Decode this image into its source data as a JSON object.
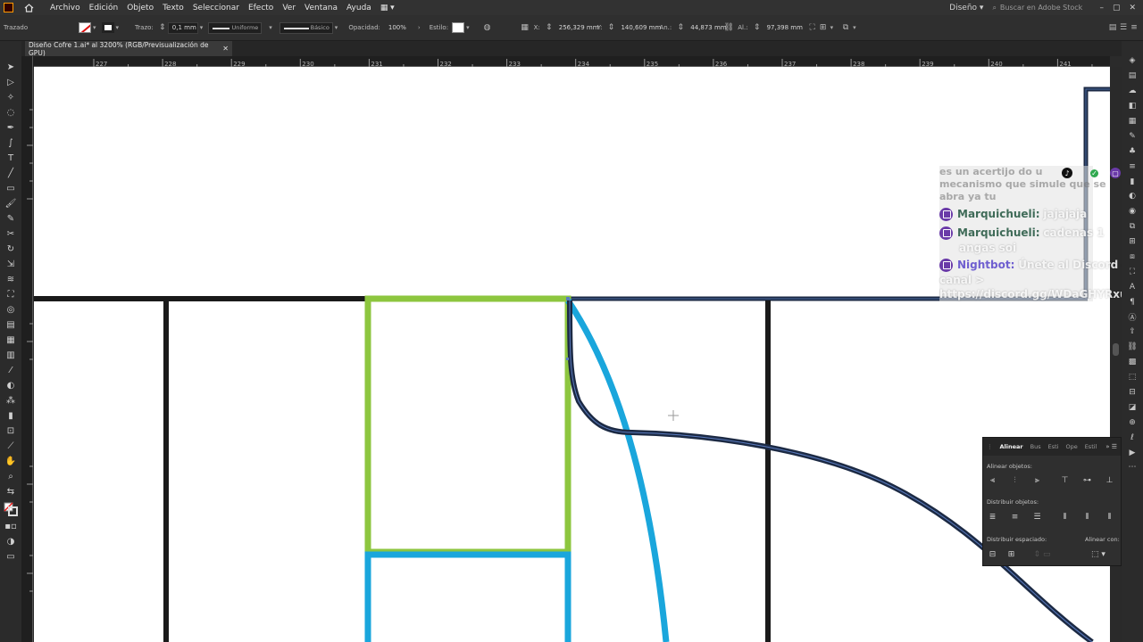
{
  "menubar": {
    "items": [
      "Archivo",
      "Edición",
      "Objeto",
      "Texto",
      "Seleccionar",
      "Efecto",
      "Ver",
      "Ventana",
      "Ayuda"
    ],
    "workspace": "Diseño",
    "search_placeholder": "Buscar en Adobe Stock"
  },
  "controlbar": {
    "object_label": "Trazado",
    "stroke_label": "Trazo:",
    "stroke_weight": "0,1 mm",
    "profile": "Uniforme",
    "brush": "Básico",
    "opacity_label": "Opacidad:",
    "opacity_value": "100%",
    "style_label": "Estilo:",
    "x_label": "X:",
    "x_value": "256,329 mm",
    "y_label": "Y:",
    "y_value": "140,609 mm",
    "w_label": "An.:",
    "w_value": "44,873 mm",
    "h_label": "Al.:",
    "h_value": "97,398 mm"
  },
  "document": {
    "tab_title": "Diseño Cofre 1.ai* al 3200% (RGB/Previsualización de GPU)"
  },
  "ruler": {
    "top_ticks": [
      "227",
      "228",
      "229",
      "230",
      "231",
      "232",
      "233",
      "234",
      "235",
      "236",
      "237",
      "238",
      "239",
      "240",
      "241"
    ]
  },
  "chat": {
    "faded_line_1": "es un acertijo do u",
    "faded_line_2": "mecanismo que simule que se",
    "faded_line_3": "abra ya tu",
    "messages": [
      {
        "user": "Marquichueli:",
        "text": "jajajaja"
      },
      {
        "user": "Marquichueli:",
        "text": "cadenas 1"
      },
      {
        "user": "Nightbot:",
        "text": "Únete al Discord del"
      }
    ],
    "faded_line_4": "angas soi",
    "nightbot_line_2": "canal >",
    "nightbot_link": "https://discord.gg/WDaGHYRxuX"
  },
  "align_panel": {
    "tabs": [
      "Alinear",
      "Bus",
      "Esti",
      "Ope",
      "Estil"
    ],
    "align_objects_label": "Alinear objetos:",
    "distribute_objects_label": "Distribuir objetos:",
    "distribute_spacing_label": "Distribuir espaciado:",
    "align_to_label": "Alinear con:"
  },
  "colors": {
    "green_stroke": "#8dc63f",
    "blue_stroke": "#1aa6dc",
    "black_stroke": "#1a1a1a",
    "navy_stroke": "#1c2a44",
    "twitch_purple": "#6a3aa8"
  }
}
